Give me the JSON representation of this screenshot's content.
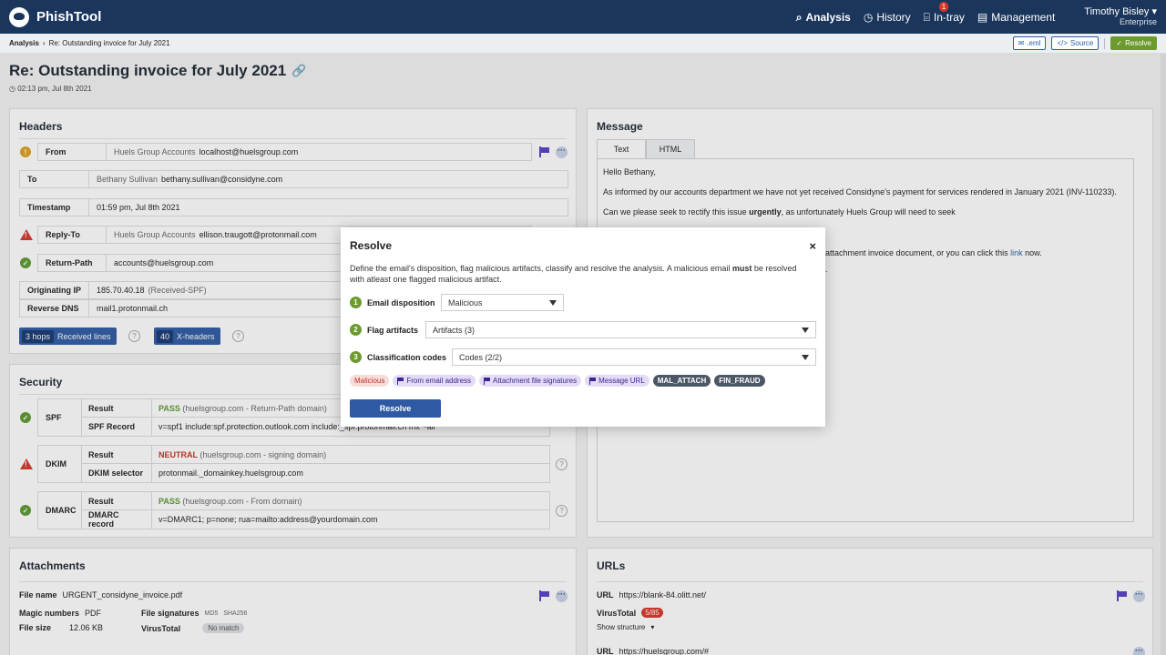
{
  "app": {
    "name": "PhishTool"
  },
  "nav": {
    "items": [
      {
        "label": "Analysis",
        "icon": "search-icon"
      },
      {
        "label": "History",
        "icon": "clock-icon"
      },
      {
        "label": "In-tray",
        "icon": "inbox-icon",
        "badge": "1"
      },
      {
        "label": "Management",
        "icon": "document-icon"
      }
    ],
    "user": {
      "name": "Timothy Bisley",
      "plan": "Enterprise"
    }
  },
  "breadcrumb": {
    "root": "Analysis",
    "current": "Re: Outstanding invoice for July 2021"
  },
  "actions": {
    "eml": ".eml",
    "source": "Source",
    "resolve": "Resolve"
  },
  "email": {
    "subject": "Re: Outstanding invoice for July 2021",
    "received": "02:13 pm, Jul 8th 2021"
  },
  "headers": {
    "title": "Headers",
    "from": {
      "label": "From",
      "name": "Huels Group Accounts",
      "address": "localhost@huelsgroup.com"
    },
    "to": {
      "label": "To",
      "name": "Bethany Sullivan",
      "address": "bethany.sullivan@considyne.com"
    },
    "timestamp": {
      "label": "Timestamp",
      "value": "01:59 pm, Jul 8th 2021"
    },
    "reply_to": {
      "label": "Reply-To",
      "name": "Huels Group Accounts",
      "address": "ellison.traugott@protonmail.com"
    },
    "return_path": {
      "label": "Return-Path",
      "value": "accounts@huelsgroup.com"
    },
    "originating_ip": {
      "label": "Originating IP",
      "value": "185.70.40.18",
      "note": "(Received-SPF)"
    },
    "reverse_dns": {
      "label": "Reverse DNS",
      "value": "mail1.protonmail.ch"
    },
    "hops": {
      "count": "3 hops",
      "label": "Received lines"
    },
    "xheaders": {
      "count": "40",
      "label": "X-headers"
    }
  },
  "security": {
    "title": "Security",
    "spf": {
      "name": "SPF",
      "result_label": "Result",
      "result": "PASS",
      "result_note": "(huelsgroup.com - Return-Path domain)",
      "record_label": "SPF Record",
      "record": "v=spf1 include:spf.protection.outlook.com include:_spf.protonmail.ch mx ~all"
    },
    "dkim": {
      "name": "DKIM",
      "result_label": "Result",
      "result": "NEUTRAL",
      "result_note": "(huelsgroup.com - signing domain)",
      "record_label": "DKIM selector",
      "record": "protonmail._domainkey.huelsgroup.com"
    },
    "dmarc": {
      "name": "DMARC",
      "result_label": "Result",
      "result": "PASS",
      "result_note": "(huelsgroup.com - From domain)",
      "record_label": "DMARC record",
      "record": "v=DMARC1; p=none; rua=mailto:address@yourdomain.com"
    }
  },
  "message": {
    "title": "Message",
    "tabs": [
      "Text",
      "HTML"
    ],
    "greeting": "Hello Bethany,",
    "p1": "As informed by our accounts department we have not yet received Considyne's payment for services rendered in January 2021 (INV-110233).",
    "p2a": "Can we please seek to rectify this issue ",
    "p2b": "urgently",
    "p2c": ", as unfortunately Huels Group will need to seek",
    "p3a": "attachment invoice document, or you can click this ",
    "p3link": "link",
    "p3b": " now.",
    "p4": "."
  },
  "attachments": {
    "title": "Attachments",
    "file_name_label": "File name",
    "file_name": "URGENT_considyne_invoice.pdf",
    "magic_label": "Magic numbers",
    "magic": "PDF",
    "size_label": "File size",
    "size": "12.06 KB",
    "sig_label": "File signatures",
    "md5": "MD5",
    "sha256": "SHA256",
    "vt_label": "VirusTotal",
    "vt": "No match"
  },
  "urls": {
    "title": "URLs",
    "items": [
      {
        "label": "URL",
        "url": "https://blank-84.olitt.net/",
        "vt_label": "VirusTotal",
        "vt": "5/85",
        "structure": "Show structure"
      },
      {
        "label": "URL",
        "url": "https://huelsgroup.com/#"
      }
    ]
  },
  "modal": {
    "title": "Resolve",
    "close": "×",
    "desc_a": "Define the email's disposition, flag malicious artifacts, classify and resolve the analysis. A malicious email ",
    "desc_b": "must",
    "desc_c": " be resolved with atleast one flagged malicious artifact.",
    "steps": [
      {
        "n": "1",
        "label": "Email disposition",
        "value": "Malicious"
      },
      {
        "n": "2",
        "label": "Flag artifacts",
        "value": "Artifacts (3)"
      },
      {
        "n": "3",
        "label": "Classification codes",
        "value": "Codes (2/2)"
      }
    ],
    "tags": [
      "Malicious",
      "From email address",
      "Attachment file signatures",
      "Message URL",
      "MAL_ATTACH",
      "FIN_FRAUD"
    ],
    "submit": "Resolve"
  },
  "colors": {
    "nav": "#1b365c",
    "accent": "#2e5aa3",
    "ok": "#5d9a31",
    "danger": "#d2392e",
    "flag": "#5b3fc4"
  }
}
